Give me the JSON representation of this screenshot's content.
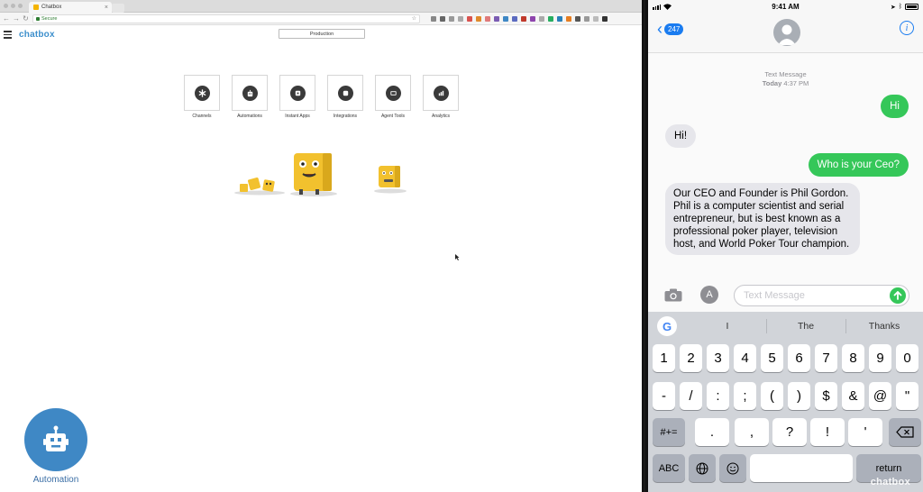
{
  "browser": {
    "tab_title": "Chatbox",
    "address": "Secure",
    "brand": "chatbox",
    "environment": "Production",
    "tiles": [
      {
        "label": "Channels",
        "icon": "asterisk-icon"
      },
      {
        "label": "Automations",
        "icon": "robot-icon"
      },
      {
        "label": "Instant Apps",
        "icon": "app-icon"
      },
      {
        "label": "Integrations",
        "icon": "integrations-icon"
      },
      {
        "label": "Agent Tools",
        "icon": "monitor-icon"
      },
      {
        "label": "Analytics",
        "icon": "bar-chart-icon"
      }
    ],
    "automation_button": "Automation"
  },
  "phone": {
    "status": {
      "time": "9:41 AM"
    },
    "nav": {
      "back_count": "247"
    },
    "thread_header": {
      "type": "Text Message",
      "day": "Today",
      "time": "4:37 PM"
    },
    "messages": [
      {
        "from": "me",
        "text": "Hi"
      },
      {
        "from": "them",
        "text": "Hi!"
      },
      {
        "from": "me",
        "text": "Who is your Ceo?"
      },
      {
        "from": "them",
        "text": "Our CEO and Founder is Phil Gordon.  Phil is a computer scientist and serial entrepreneur, but is best known as a professional poker player, television host, and World Poker Tour champion."
      }
    ],
    "compose_placeholder": "Text Message",
    "suggestions": [
      "I",
      "The",
      "Thanks"
    ],
    "keyboard": {
      "row1": [
        "1",
        "2",
        "3",
        "4",
        "5",
        "6",
        "7",
        "8",
        "9",
        "0"
      ],
      "row2": [
        "-",
        "/",
        ":",
        ";",
        "(",
        ")",
        "$",
        "&",
        "@",
        "\""
      ],
      "row3": [
        "#+=",
        ".",
        ",",
        "?",
        "!",
        "'"
      ],
      "row4": [
        "ABC",
        "return"
      ]
    },
    "watermark": "chatbox"
  },
  "colors": {
    "sent_bubble": "#35c759",
    "received_bubble": "#e6e6eb",
    "ios_blue": "#1a7cf0",
    "brand_blue": "#3f88c5"
  }
}
